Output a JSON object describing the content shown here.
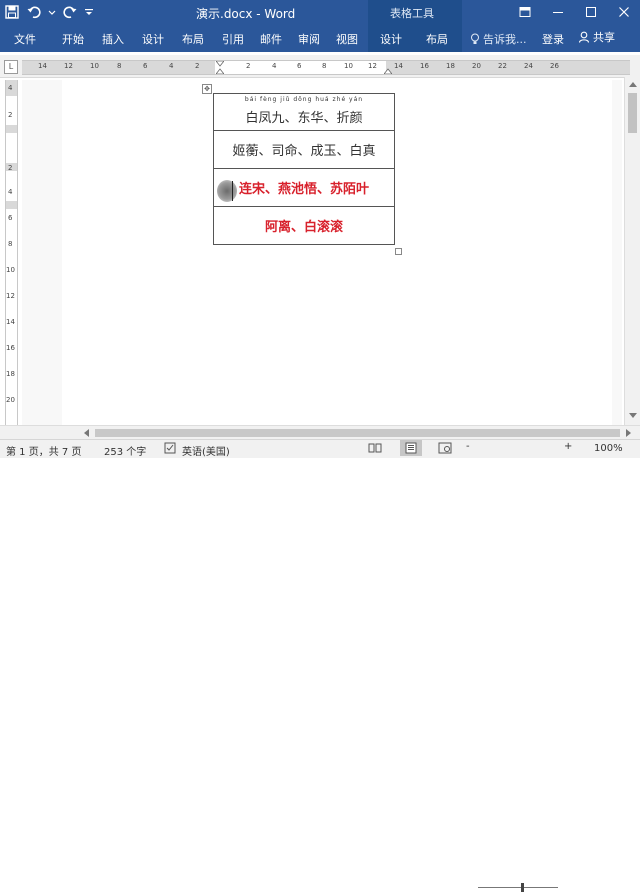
{
  "titlebar": {
    "title": "演示.docx - Word",
    "context_header": "表格工具",
    "icons": [
      "save-icon",
      "undo-icon",
      "redo-icon",
      "customize-icon",
      "ribbon-display-icon",
      "minimize-icon",
      "maximize-icon",
      "close-icon"
    ]
  },
  "ribbon": {
    "tabs": [
      "文件",
      "开始",
      "插入",
      "设计",
      "布局",
      "引用",
      "邮件",
      "审阅",
      "视图"
    ],
    "context_tabs": [
      "设计",
      "布局"
    ],
    "tell_me": "告诉我...",
    "login": "登录",
    "share": "共享"
  },
  "ruler": {
    "tab_selector": "L",
    "h_labels": [
      "14",
      "12",
      "10",
      "8",
      "6",
      "4",
      "2",
      "2",
      "4",
      "6",
      "8",
      "10",
      "12",
      "14",
      "16",
      "18",
      "20",
      "22",
      "24",
      "26"
    ],
    "v_labels": [
      "4",
      "2",
      "2",
      "4",
      "6",
      "8",
      "10",
      "12",
      "14",
      "16",
      "18",
      "20"
    ]
  },
  "document": {
    "rows": [
      {
        "pinyin": "bái fèng jiǔ   dōng huá   zhé yán",
        "text": "白凤九、东华、折颜"
      },
      {
        "text": "姬蘅、司命、成玉、白真"
      },
      {
        "text": "连宋、燕池悟、苏陌叶"
      },
      {
        "text": "阿离、白滚滚"
      }
    ],
    "colors": {
      "red_text": "#d8212c"
    }
  },
  "statusbar": {
    "page": "第 1 页，共 7 页",
    "words": "253 个字",
    "language": "英语(美国)",
    "zoom": "100%",
    "zoom_minus": "-",
    "zoom_plus": "+"
  }
}
